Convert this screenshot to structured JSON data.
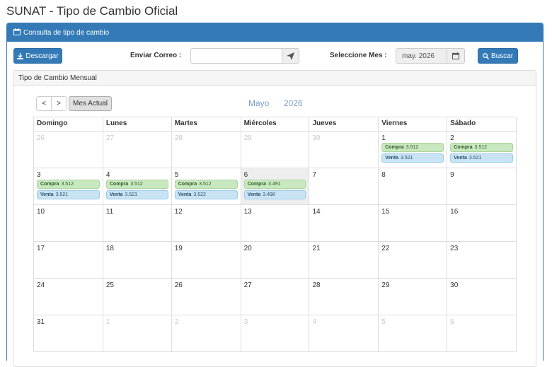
{
  "page_title": "SUNAT - Tipo de Cambio Oficial",
  "panel_title": "Consulta de tipo de cambio",
  "toolbar": {
    "download_label": "Descargar",
    "email_label": "Enviar Correo :",
    "email_value": "",
    "month_label": "Seleccione Mes :",
    "month_value": "may. 2026",
    "search_label": "Buscar"
  },
  "calendar": {
    "panel_title": "Tipo de Cambio Mensual",
    "prev": "<",
    "next": ">",
    "current_btn": "Mes Actual",
    "month": "Mayo",
    "year": "2026",
    "weekdays": [
      "Domingo",
      "Lunes",
      "Martes",
      "Miércoles",
      "Jueves",
      "Viernes",
      "Sábado"
    ],
    "compra_label": "Compra",
    "venta_label": "Venta",
    "weeks": [
      [
        {
          "d": "26",
          "m": true
        },
        {
          "d": "27",
          "m": true
        },
        {
          "d": "28",
          "m": true
        },
        {
          "d": "29",
          "m": true
        },
        {
          "d": "30",
          "m": true
        },
        {
          "d": "1",
          "c": "3.512",
          "v": "3.521"
        },
        {
          "d": "2",
          "c": "3.512",
          "v": "3.521"
        }
      ],
      [
        {
          "d": "3",
          "c": "3.512",
          "v": "3.521"
        },
        {
          "d": "4",
          "c": "3.512",
          "v": "3.521"
        },
        {
          "d": "5",
          "c": "3.512",
          "v": "3.522"
        },
        {
          "d": "6",
          "c": "3.491",
          "v": "3.498",
          "t": true
        },
        {
          "d": "7"
        },
        {
          "d": "8"
        },
        {
          "d": "9"
        }
      ],
      [
        {
          "d": "10"
        },
        {
          "d": "11"
        },
        {
          "d": "12"
        },
        {
          "d": "13"
        },
        {
          "d": "14"
        },
        {
          "d": "15"
        },
        {
          "d": "16"
        }
      ],
      [
        {
          "d": "17"
        },
        {
          "d": "18"
        },
        {
          "d": "19"
        },
        {
          "d": "20"
        },
        {
          "d": "21"
        },
        {
          "d": "22"
        },
        {
          "d": "23"
        }
      ],
      [
        {
          "d": "24"
        },
        {
          "d": "25"
        },
        {
          "d": "26"
        },
        {
          "d": "27"
        },
        {
          "d": "28"
        },
        {
          "d": "29"
        },
        {
          "d": "30"
        }
      ],
      [
        {
          "d": "31"
        },
        {
          "d": "1",
          "m": true
        },
        {
          "d": "2",
          "m": true
        },
        {
          "d": "3",
          "m": true
        },
        {
          "d": "4",
          "m": true
        },
        {
          "d": "5",
          "m": true
        },
        {
          "d": "6",
          "m": true
        }
      ]
    ]
  }
}
